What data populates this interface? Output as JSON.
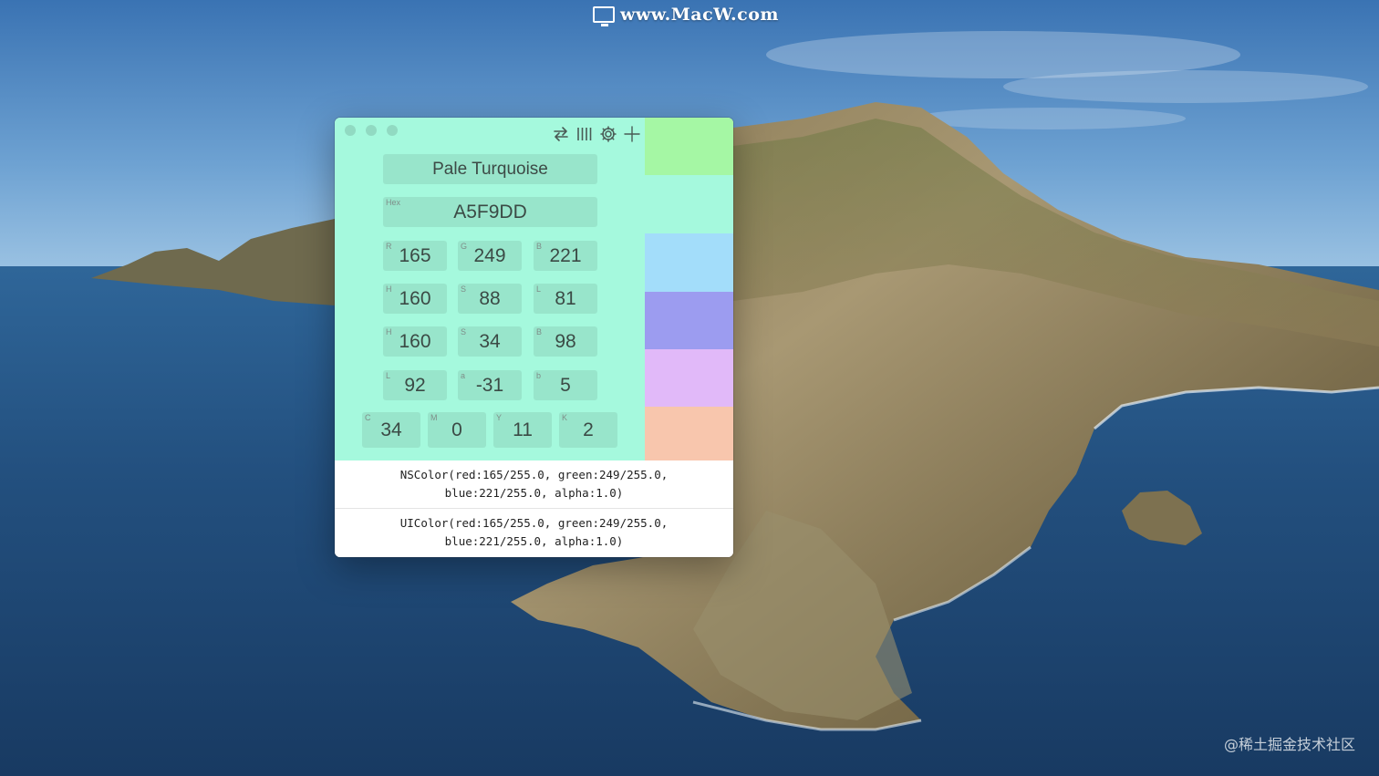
{
  "desktop": {
    "watermark_top": "www.MacW.com",
    "watermark_bottom": "@稀土掘金技术社区"
  },
  "window": {
    "color_name": "Pale Turquoise",
    "hex": {
      "label": "Hex",
      "value": "A5F9DD"
    },
    "rgb": [
      {
        "label": "R",
        "value": "165"
      },
      {
        "label": "G",
        "value": "249"
      },
      {
        "label": "B",
        "value": "221"
      }
    ],
    "hsl": [
      {
        "label": "H",
        "value": "160"
      },
      {
        "label": "S",
        "value": "88"
      },
      {
        "label": "L",
        "value": "81"
      }
    ],
    "hsb": [
      {
        "label": "H",
        "value": "160"
      },
      {
        "label": "S",
        "value": "34"
      },
      {
        "label": "B",
        "value": "98"
      }
    ],
    "lab": [
      {
        "label": "L",
        "value": "92"
      },
      {
        "label": "a",
        "value": "-31"
      },
      {
        "label": "b",
        "value": "5"
      }
    ],
    "cmyk": [
      {
        "label": "C",
        "value": "34"
      },
      {
        "label": "M",
        "value": "0"
      },
      {
        "label": "Y",
        "value": "11"
      },
      {
        "label": "K",
        "value": "2"
      }
    ],
    "toolbar_icons": [
      "swap-arrows-icon",
      "columns-icon",
      "gear-icon",
      "plus-icon"
    ],
    "swatches": [
      "#a5f7a4",
      "#a5f9dd",
      "#a3ddfa",
      "#9c9cf0",
      "#e1b9f9",
      "#f8c6ad"
    ],
    "nscolor_line1": "NSColor(red:165/255.0, green:249/255.0,",
    "nscolor_line2": "blue:221/255.0, alpha:1.0)",
    "uicolor_line1": "UIColor(red:165/255.0, green:249/255.0,",
    "uicolor_line2": "blue:221/255.0, alpha:1.0)"
  }
}
